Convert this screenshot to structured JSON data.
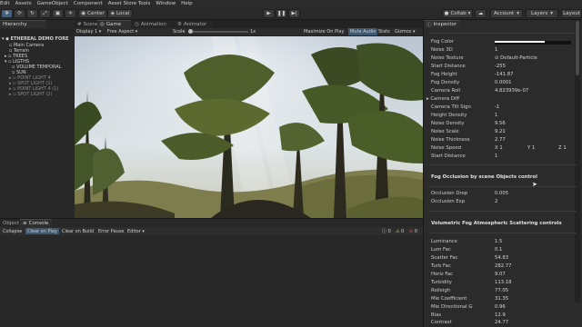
{
  "menubar": {
    "items": [
      "Edit",
      "Assets",
      "GameObject",
      "Component",
      "Asset Store Tools",
      "Window",
      "Help"
    ]
  },
  "toolbar": {
    "center_label": "Center",
    "local_label": "Local",
    "collab_label": "Collab",
    "account_label": "Account",
    "layers_label": "Layers",
    "layout_label": "Layout"
  },
  "hierarchy": {
    "tab_label": "Hierarchy",
    "rows": [
      {
        "label": "ETHEREAL DEMO FORE",
        "dim": false
      },
      {
        "label": "Main Camera",
        "dim": false
      },
      {
        "label": "Terrain",
        "dim": false
      },
      {
        "label": "TREES",
        "dim": false
      },
      {
        "label": "LIGTHS",
        "dim": false
      },
      {
        "label": "VOLUME TEMPORAL",
        "dim": false
      },
      {
        "label": "SUN",
        "dim": false
      },
      {
        "label": "POINT LIGHT 4",
        "dim": true
      },
      {
        "label": "SPOT LIGHT (1)",
        "dim": true
      },
      {
        "label": "POINT LIGHT 4 (1)",
        "dim": true
      },
      {
        "label": "SPOT LIGHT (2)",
        "dim": true
      }
    ]
  },
  "scene": {
    "tab_scene": "Scene",
    "tab_game": "Game",
    "tab_animation": "Animation",
    "tab_animator": "Animator",
    "display_label": "Display 1",
    "aspect_label": "Free Aspect",
    "scale_label": "Scale",
    "scale_value": "1x",
    "maximize_label": "Maximize On Play",
    "mute_label": "Mute Audio",
    "stats_label": "Stats",
    "gizmos_label": "Gizmos"
  },
  "console": {
    "tab_object": "Object",
    "tab_console": "Console",
    "collapse_label": "Collapse",
    "clear_on_play_label": "Clear on Play",
    "clear_on_build_label": "Clear on Build",
    "error_pause_label": "Error Pause",
    "editor_label": "Editor",
    "count_0": "0",
    "count_1": "0",
    "count_2": "0"
  },
  "inspector": {
    "tab_label": "Inspector",
    "fields": [
      {
        "label": "Fog Color",
        "value": ""
      },
      {
        "label": "Noise 3D",
        "value": "1"
      },
      {
        "label": "Noise Texture",
        "value": "Default-Particle"
      },
      {
        "label": "Start Distance",
        "value": "-255"
      },
      {
        "label": "Fog Height",
        "value": "-141.87"
      },
      {
        "label": "Fog Density",
        "value": "0.0001"
      },
      {
        "label": "Camera Roll",
        "value": "4.823939e-07"
      },
      {
        "label": "Camera Diff",
        "value": ""
      },
      {
        "label": "Camera Tilt Sign",
        "value": "-1"
      },
      {
        "label": "Height Density",
        "value": "1"
      },
      {
        "label": "Noise Density",
        "value": "9.56"
      },
      {
        "label": "Noise Scale",
        "value": "9.21"
      },
      {
        "label": "Noise Thickness",
        "value": "2.77"
      },
      {
        "label": "Noise Speed",
        "value": ""
      },
      {
        "label": "Start Distance",
        "value": "1"
      }
    ],
    "noise_speed": {
      "x_label": "X",
      "x": "1",
      "y_label": "Y",
      "y": "1",
      "z_label": "Z",
      "z": "1"
    },
    "section_occlusion": "Fog Occlusion by scene Objects control",
    "occlusion_fields": [
      {
        "label": "Occlusion Drop",
        "value": "0.005"
      },
      {
        "label": "Occlusion Exp",
        "value": "2"
      }
    ],
    "section_scattering": "Volumetric Fog Atmospheric Scattering controls",
    "scattering_fields": [
      {
        "label": "Luminance",
        "value": "1.5"
      },
      {
        "label": "Lum Fac",
        "value": "0.1"
      },
      {
        "label": "Scatter Fac",
        "value": "54.83"
      },
      {
        "label": "Turb Fac",
        "value": "282.77"
      },
      {
        "label": "Horiz Fac",
        "value": "9.07"
      },
      {
        "label": "Turbidity",
        "value": "113.18"
      },
      {
        "label": "Reileigh",
        "value": "77.05"
      },
      {
        "label": "Mie Coefficient",
        "value": "31.35"
      },
      {
        "label": "Mie Directional G",
        "value": "0.96"
      },
      {
        "label": "Bias",
        "value": "12.9"
      },
      {
        "label": "Contrast",
        "value": "24.77"
      }
    ]
  },
  "colors": {
    "fog_color": "#ffffff",
    "accent": "#46607c"
  }
}
